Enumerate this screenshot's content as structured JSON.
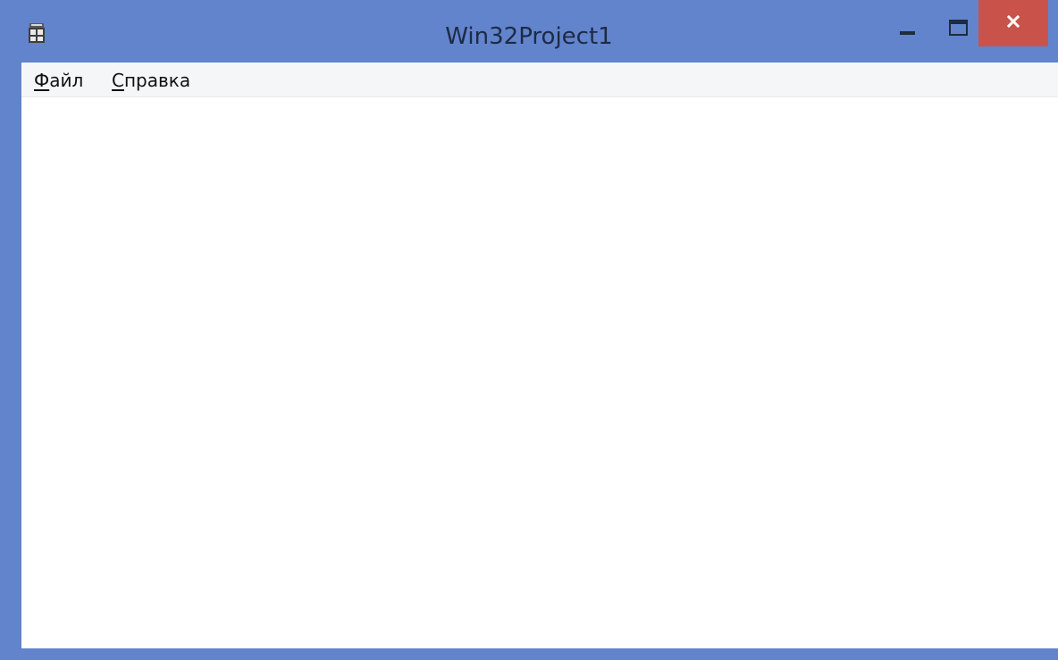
{
  "window": {
    "title": "Win32Project1",
    "frame_color": "#6184cc",
    "close_button_color": "#c9534b",
    "icon": "application-window-icon",
    "controls": {
      "minimize": "minimize-icon",
      "maximize": "maximize-icon",
      "close": "close-icon"
    }
  },
  "menubar": {
    "items": [
      {
        "accel": "Ф",
        "rest": "айл"
      },
      {
        "accel": "С",
        "rest": "правка"
      }
    ]
  }
}
